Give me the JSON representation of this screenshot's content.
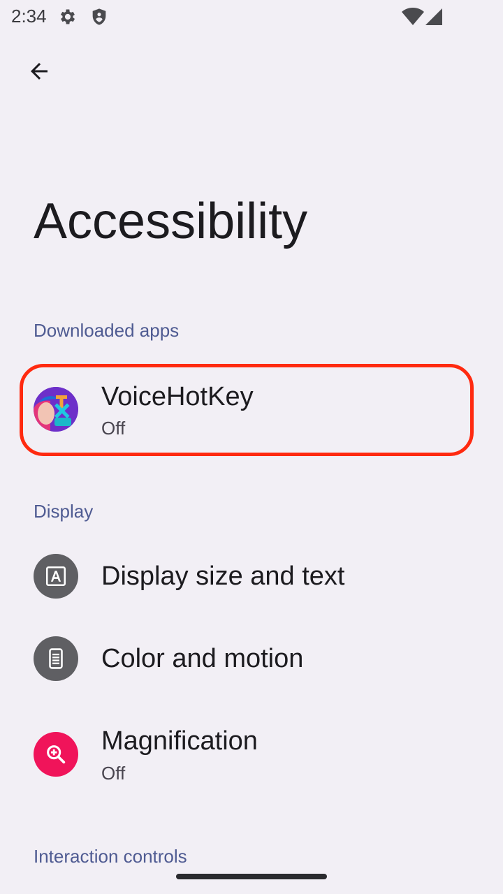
{
  "status_bar": {
    "time": "2:34",
    "icons": [
      "gear-icon",
      "shield-icon",
      "wifi-icon",
      "cell-signal-icon"
    ]
  },
  "header": {
    "back_icon": "arrow-left-icon",
    "title": "Accessibility"
  },
  "sections": {
    "downloaded_apps": {
      "label": "Downloaded apps",
      "items": [
        {
          "title": "VoiceHotKey",
          "summary": "Off",
          "icon": "voicehotkey-app-icon"
        }
      ]
    },
    "display": {
      "label": "Display",
      "items": [
        {
          "title": "Display size and text",
          "icon": "text-size-icon"
        },
        {
          "title": "Color and motion",
          "icon": "color-motion-icon"
        },
        {
          "title": "Magnification",
          "summary": "Off",
          "icon": "magnify-plus-icon"
        }
      ]
    },
    "interaction_controls": {
      "label": "Interaction controls"
    }
  },
  "colors": {
    "background": "#f2eff5",
    "section_header": "#4f5b92",
    "gray_icon_bg": "#5f5f63",
    "magnification_icon_bg": "#f0145a",
    "highlight": "#ff2a10"
  }
}
